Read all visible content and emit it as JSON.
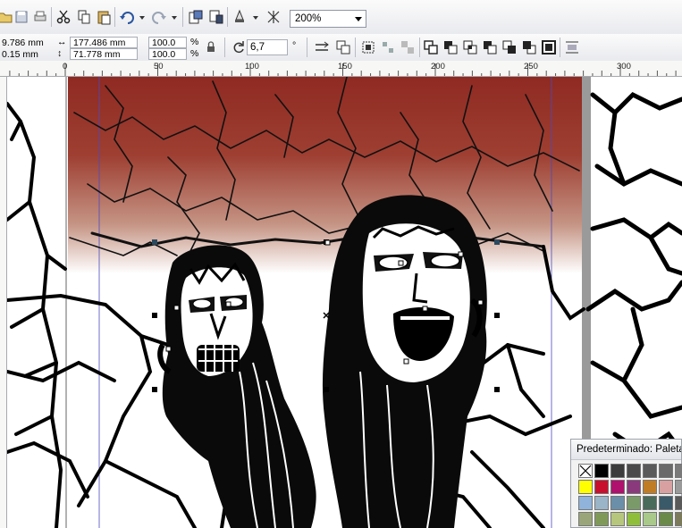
{
  "toolbar": {
    "zoom_value": "200%"
  },
  "properties": {
    "x_value": "9.786 mm",
    "y_value": "0.15 mm",
    "width_value": "177.486 mm",
    "height_value": "71.778 mm",
    "scale_x": "100.0",
    "scale_y": "100.0",
    "percent_symbol": "%",
    "rotation_value": "6,7",
    "degree_symbol": "°"
  },
  "ruler": {
    "labels": [
      "0",
      "50",
      "100",
      "150",
      "200",
      "250",
      "300"
    ]
  },
  "palette": {
    "title": "Predeterminado: Paleta",
    "colors": [
      "#ffffff",
      "#000000",
      "#3c3c3c",
      "#4a4a4a",
      "#5a5a5a",
      "#6a6a6a",
      "#7a7a7a",
      "#ffff00",
      "#c8102e",
      "#b0106e",
      "#8a3a7c",
      "#c07c25",
      "#d8a0a0",
      "#9a9a9a",
      "#8fb3da",
      "#9ab4c8",
      "#6b8fa8",
      "#7a9a6a",
      "#4a6a5a",
      "#3a5a6a",
      "#5a5a5a",
      "#9aa67a",
      "#7f9a58",
      "#b6c67c",
      "#8fbf3a",
      "#a9c98a",
      "#6a8a4a",
      "#7b7b5b"
    ]
  },
  "colors": {
    "sky_top": "#8f2a22",
    "sky_mid": "#b06a5e",
    "guide": "#4a4abf"
  }
}
